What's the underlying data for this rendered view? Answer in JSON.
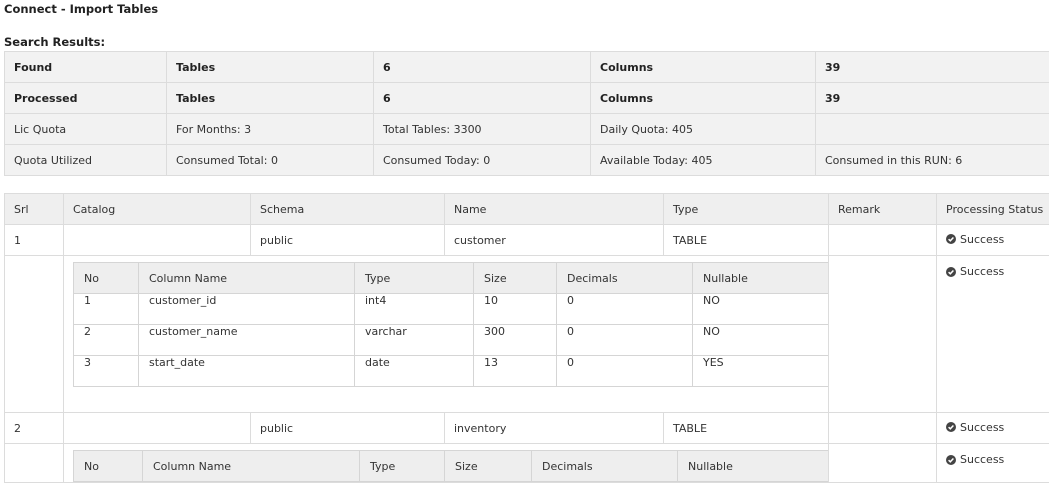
{
  "page": {
    "title": "Connect - Import Tables",
    "search_results_label": "Search Results:"
  },
  "colors": {
    "header_bg": "#efefef",
    "border": "#dcdcdc",
    "text": "#333333",
    "check_icon": "#444444"
  },
  "summary": {
    "rows": [
      [
        "Found",
        "Tables",
        "6",
        "Columns",
        "39"
      ],
      [
        "Processed",
        "Tables",
        "6",
        "Columns",
        "39"
      ],
      [
        "Lic Quota",
        "For Months: 3",
        "Total Tables: 3300",
        "Daily Quota: 405",
        ""
      ],
      [
        "Quota Utilized",
        "Consumed Total: 0",
        "Consumed Today: 0",
        "Available Today: 405",
        "Consumed in this RUN: 6"
      ]
    ]
  },
  "results": {
    "headers": [
      "Srl",
      "Catalog",
      "Schema",
      "Name",
      "Type",
      "Remark",
      "Processing Status"
    ],
    "status_icon": "check-circle-icon",
    "rows": [
      {
        "srl": "1",
        "catalog": "",
        "schema": "public",
        "name": "customer",
        "type": "TABLE",
        "remark": "",
        "status": "Success",
        "detail_status": "Success",
        "columns_headers": [
          "No",
          "Column Name",
          "Type",
          "Size",
          "Decimals",
          "Nullable"
        ],
        "columns": [
          [
            "1",
            "customer_id",
            "int4",
            "10",
            "0",
            "NO"
          ],
          [
            "2",
            "customer_name",
            "varchar",
            "300",
            "0",
            "NO"
          ],
          [
            "3",
            "start_date",
            "date",
            "13",
            "0",
            "YES"
          ]
        ]
      },
      {
        "srl": "2",
        "catalog": "",
        "schema": "public",
        "name": "inventory",
        "type": "TABLE",
        "remark": "",
        "status": "Success",
        "detail_status": "Success",
        "columns_headers": [
          "No",
          "Column Name",
          "Type",
          "Size",
          "Decimals",
          "Nullable"
        ],
        "columns": []
      }
    ]
  }
}
